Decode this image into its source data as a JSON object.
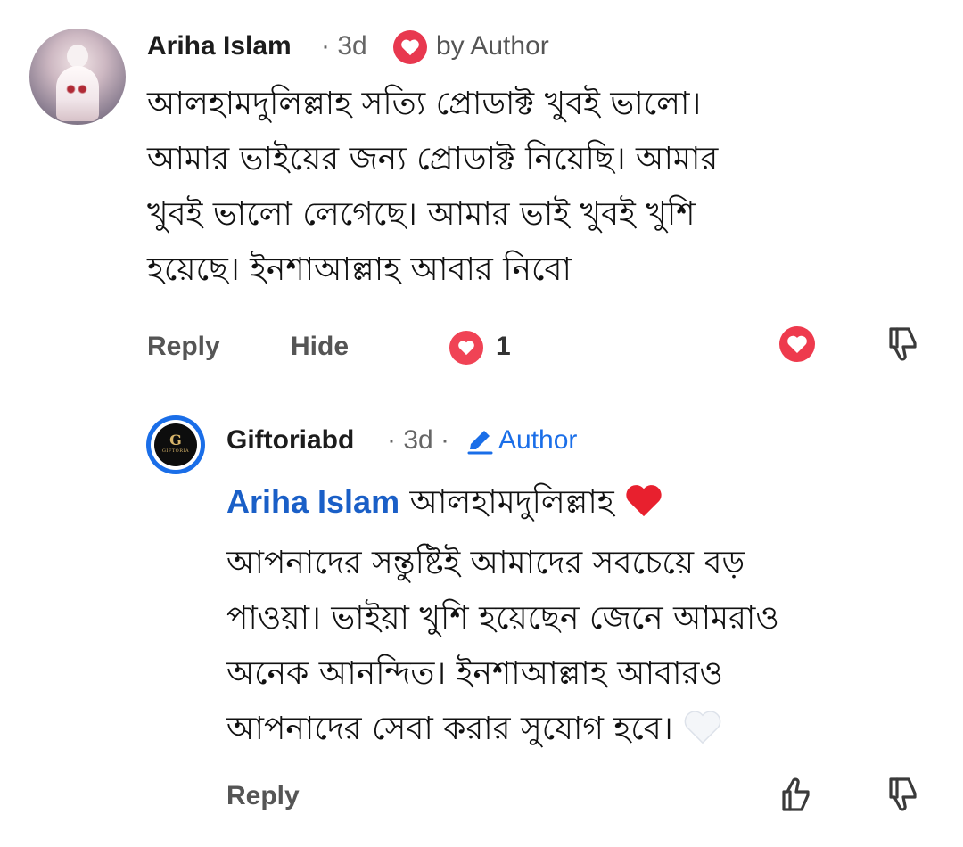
{
  "comment": {
    "author": "Ariha Islam",
    "time": "· 3d",
    "badge_label": "by Author",
    "text_lines": [
      "আলহামদুলিল্লাহ সত্যি প্রোডাক্ট খুবই ভালো।",
      "আমার ভাইয়ের জন্য প্রোডাক্ট নিয়েছি। আমার",
      "খুবই ভালো লেগেছে। আমার ভাই খুবই খুশি",
      "হয়েছে। ইনশাআল্লাহ আবার নিবো"
    ],
    "actions": {
      "reply": "Reply",
      "hide": "Hide"
    },
    "reaction_count": "1",
    "icons": [
      "heart-icon",
      "love-reaction-icon",
      "dislike-icon"
    ]
  },
  "reply": {
    "author": "Giftoriabd",
    "time": "· 3d ·",
    "role_label": "Author",
    "logo_text": {
      "mark": "G",
      "wordmark": "GIFTORIA"
    },
    "mention": "Ariha Islam",
    "text_first": " আলহামদুলিল্লাহ ",
    "text_lines": [
      "আপনাদের সন্তুষ্টিই আমাদের সবচেয়ে বড়",
      "পাওয়া। ভাইয়া খুশি হয়েছেন জেনে আমরাও",
      "অনেক আনন্দিত। ইনশাআল্লাহ আবারও",
      "আপনাদের সেবা করার সুযোগ হবে। "
    ],
    "actions": {
      "reply": "Reply"
    },
    "icons": [
      "red-heart-emoji",
      "white-heart-emoji",
      "pencil-icon",
      "like-icon",
      "dislike-icon"
    ]
  },
  "colors": {
    "accent_blue": "#1a6ee8",
    "mention_blue": "#1a5fc7",
    "heart_red": "#e8384f",
    "muted_text": "#555555"
  }
}
